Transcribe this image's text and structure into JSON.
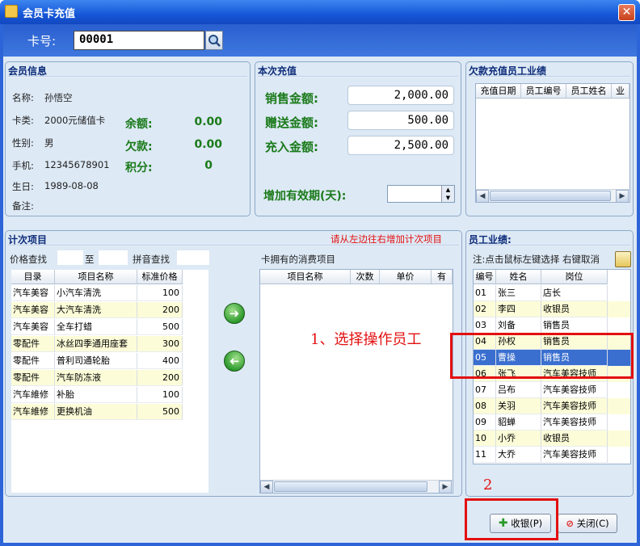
{
  "window": {
    "title": "会员卡充值",
    "close": "✕"
  },
  "card": {
    "label": "卡号:",
    "value": "00001"
  },
  "member": {
    "title": "会员信息",
    "fields": [
      {
        "label": "名称:",
        "value": "孙悟空"
      },
      {
        "label": "卡类:",
        "value": "2000元储值卡"
      },
      {
        "label": "性别:",
        "value": "男"
      },
      {
        "label": "手机:",
        "value": "12345678901"
      },
      {
        "label": "生日:",
        "value": "1989-08-08"
      },
      {
        "label": "备注:",
        "value": ""
      }
    ],
    "balance_label": "余额:",
    "balance": "0.00",
    "debt_label": "欠款:",
    "debt": "0.00",
    "points_label": "积分:",
    "points": "0"
  },
  "recharge": {
    "title": "本次充值",
    "sale_label": "销售金额:",
    "sale": "2,000.00",
    "gift_label": "赠送金额:",
    "gift": "500.00",
    "charge_label": "充入金额:",
    "charge": "2,500.00",
    "validity_label": "增加有效期(天):",
    "validity": ""
  },
  "debt_panel": {
    "title": "欠款充值员工业绩",
    "columns": [
      "充值日期",
      "员工编号",
      "员工姓名",
      "业"
    ]
  },
  "count_items": {
    "title": "计次项目",
    "hint": "请从左边往右增加计次项目",
    "price_search": "价格查找",
    "to": "至",
    "pinyin_search": "拼音查找",
    "columns": [
      "目录",
      "项目名称",
      "标准价格"
    ],
    "rows": [
      [
        "汽车美容",
        "小汽车清洗",
        "100"
      ],
      [
        "汽车美容",
        "大汽车清洗",
        "200"
      ],
      [
        "汽车美容",
        "全车打蜡",
        "500"
      ],
      [
        "零配件",
        "冰丝四季通用座套",
        "300"
      ],
      [
        "零配件",
        "普利司通轮胎",
        "400"
      ],
      [
        "零配件",
        "汽车防冻液",
        "200"
      ],
      [
        "汽车維修",
        "补胎",
        "100"
      ],
      [
        "汽车維修",
        "更换机油",
        "500"
      ]
    ],
    "owned_title": "卡拥有的消费项目",
    "owned_columns": [
      "项目名称",
      "次数",
      "单价",
      "有"
    ]
  },
  "staff": {
    "title": "员工业绩:",
    "note": "注:点击鼠标左键选择 右键取消",
    "columns": [
      "编号",
      "姓名",
      "岗位"
    ],
    "rows": [
      [
        "01",
        "张三",
        "店长"
      ],
      [
        "02",
        "李四",
        "收银员"
      ],
      [
        "03",
        "刘备",
        "销售员"
      ],
      [
        "04",
        "孙权",
        "销售员"
      ],
      [
        "05",
        "曹操",
        "销售员"
      ],
      [
        "06",
        "张飞",
        "汽车美容技师"
      ],
      [
        "07",
        "吕布",
        "汽车美容技师"
      ],
      [
        "08",
        "关羽",
        "汽车美容技师"
      ],
      [
        "09",
        "貂蝉",
        "汽车美容技师"
      ],
      [
        "10",
        "小乔",
        "收银员"
      ],
      [
        "11",
        "大乔",
        "汽车美容技师"
      ]
    ],
    "selected_index": 4
  },
  "annotations": {
    "step1": "1、选择操作员工",
    "step2": "2"
  },
  "buttons": {
    "checkout": "收银(P)",
    "close": "关闭(C)"
  },
  "colors": {
    "accent_red": "#e31010",
    "selected_row": "#3a6fd0",
    "value_green": "#1a7a1a"
  }
}
